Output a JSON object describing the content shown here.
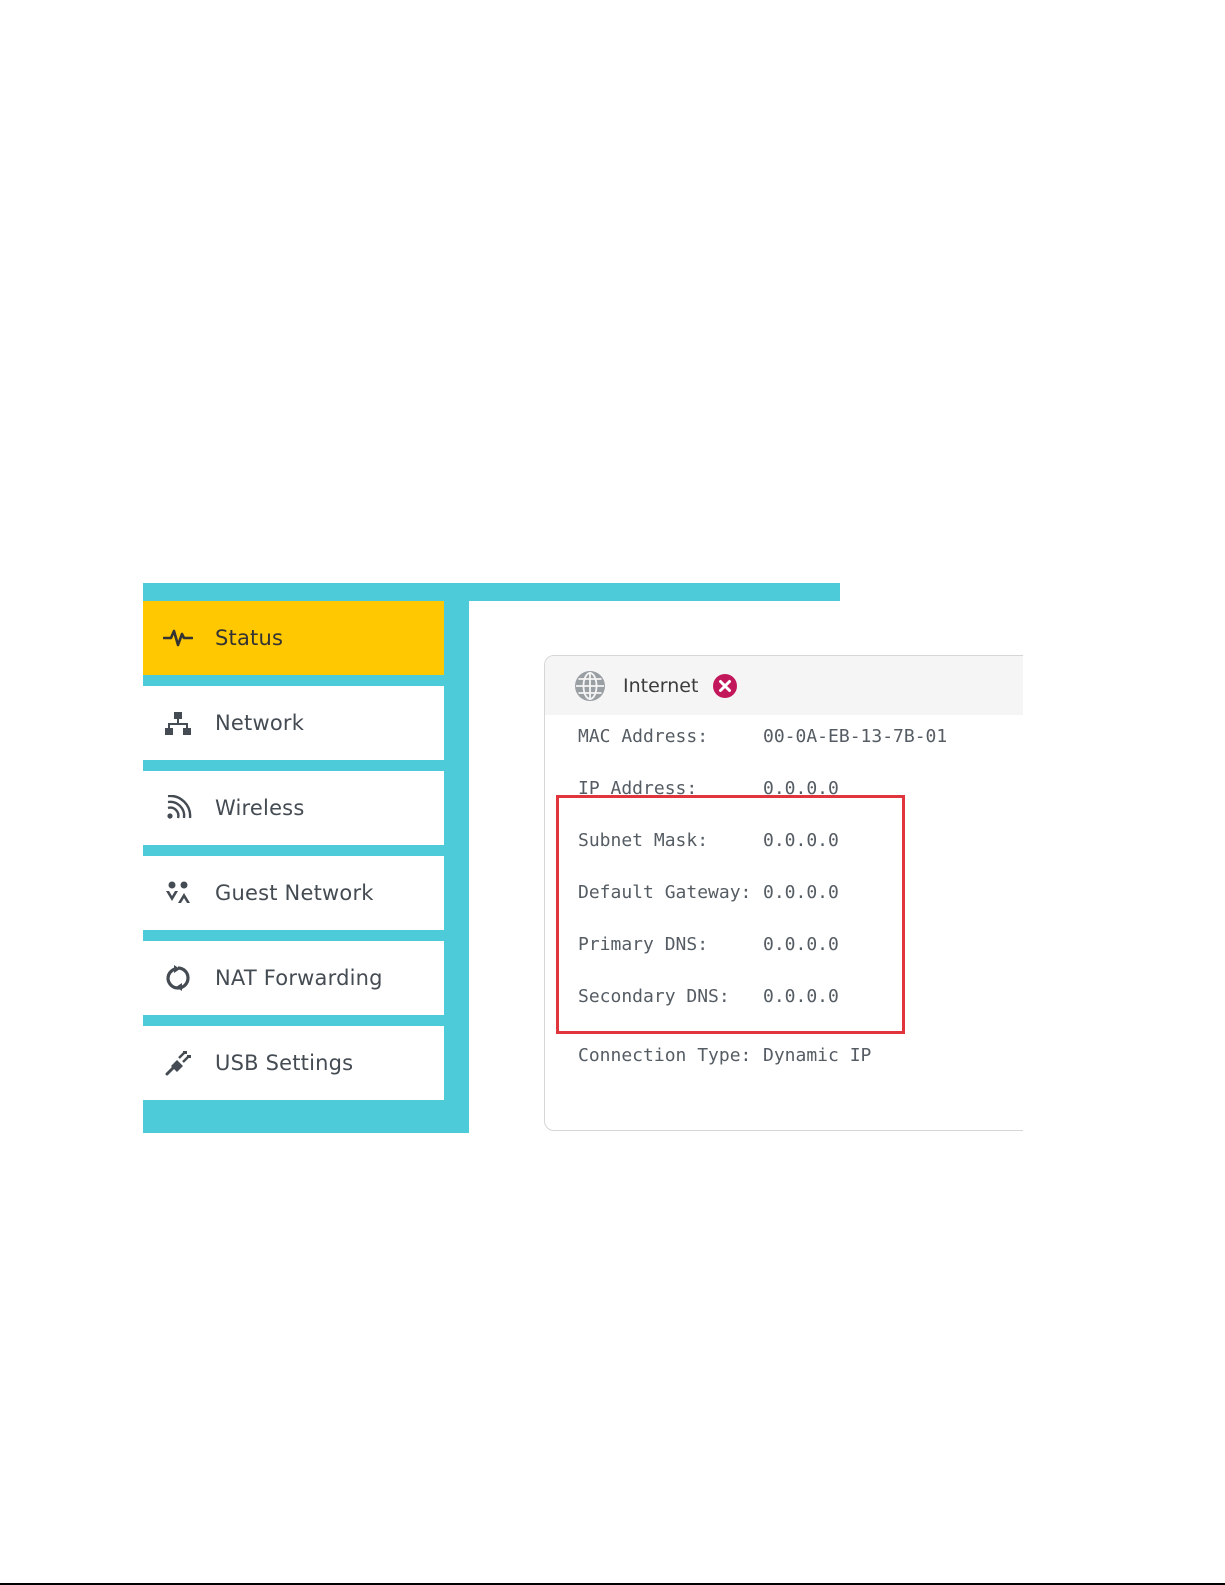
{
  "sidebar": {
    "items": [
      {
        "label": "Status",
        "icon": "pulse-icon",
        "active": true
      },
      {
        "label": "Network",
        "icon": "network-icon",
        "active": false
      },
      {
        "label": "Wireless",
        "icon": "wireless-icon",
        "active": false
      },
      {
        "label": "Guest Network",
        "icon": "guest-network-icon",
        "active": false
      },
      {
        "label": "NAT Forwarding",
        "icon": "nat-forwarding-icon",
        "active": false
      },
      {
        "label": "USB Settings",
        "icon": "usb-icon",
        "active": false
      }
    ]
  },
  "internet_card": {
    "title": "Internet",
    "status_icon": "disconnected-x-icon",
    "rows": [
      {
        "label": "MAC Address:",
        "value": "00-0A-EB-13-7B-01"
      },
      {
        "label": "IP Address:",
        "value": "0.0.0.0"
      },
      {
        "label": "Subnet Mask:",
        "value": "0.0.0.0"
      },
      {
        "label": "Default Gateway:",
        "value": "0.0.0.0"
      },
      {
        "label": "Primary DNS:",
        "value": "0.0.0.0"
      },
      {
        "label": "Secondary DNS:",
        "value": "0.0.0.0"
      },
      {
        "label": "Connection Type:",
        "value": "Dynamic IP"
      }
    ]
  },
  "colors": {
    "teal": "#4dcbd8",
    "active_yellow": "#ffc800",
    "highlight_red": "#e0353d",
    "status_magenta": "#c2185b"
  }
}
